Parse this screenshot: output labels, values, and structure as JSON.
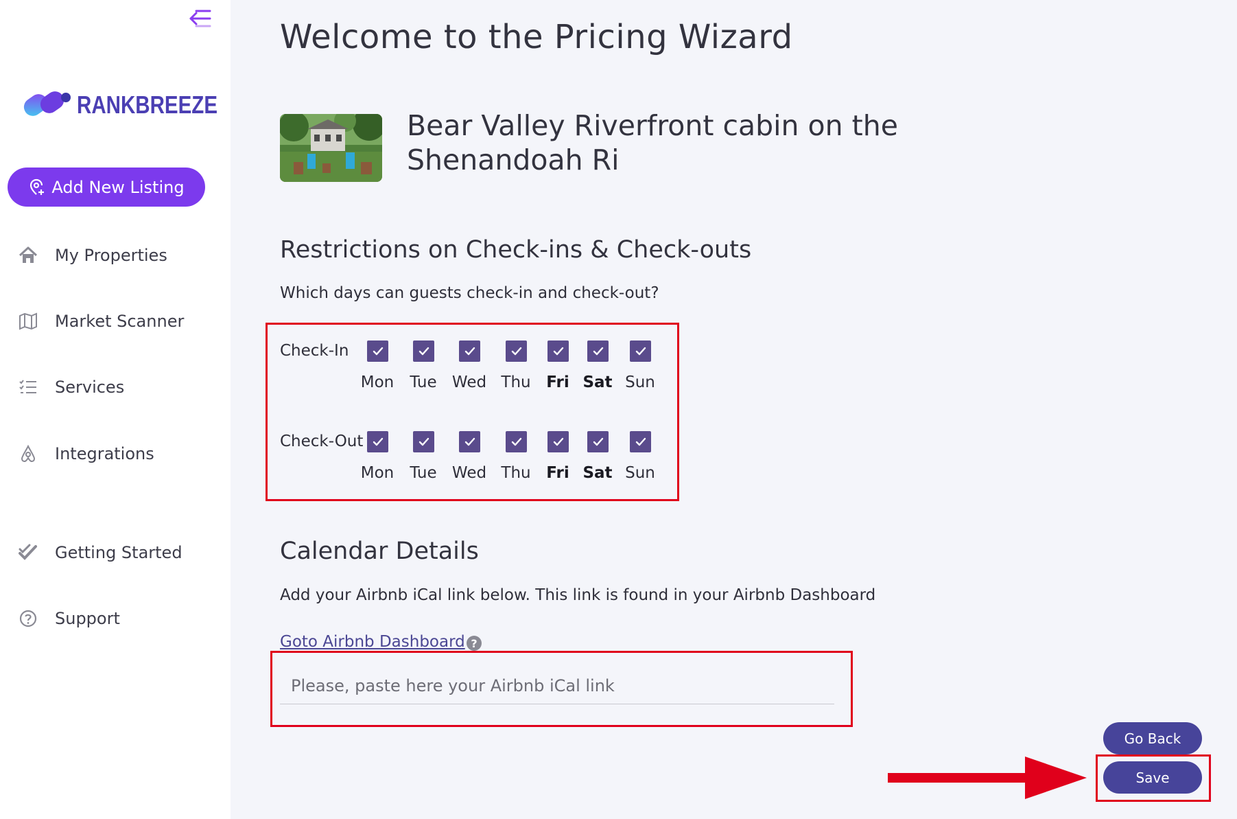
{
  "sidebar": {
    "logo_text": "RANKBREEZE",
    "add_button_label": "Add New Listing",
    "nav": [
      {
        "label": "My Properties",
        "icon": "home-icon"
      },
      {
        "label": "Market Scanner",
        "icon": "map-icon"
      },
      {
        "label": "Services",
        "icon": "list-check-icon"
      },
      {
        "label": "Integrations",
        "icon": "airbnb-icon"
      },
      {
        "label": "Getting Started",
        "icon": "double-check-icon"
      },
      {
        "label": "Support",
        "icon": "question-circle-icon"
      }
    ]
  },
  "main": {
    "page_title": "Welcome to the Pricing Wizard",
    "listing_title": "Bear Valley Riverfront cabin on the Shenandoah Ri",
    "restrictions": {
      "heading": "Restrictions on Check-ins & Check-outs",
      "question": "Which days can guests check-in and check-out?",
      "checkin_label": "Check-In",
      "checkout_label": "Check-Out",
      "days": [
        "Mon",
        "Tue",
        "Wed",
        "Thu",
        "Fri",
        "Sat",
        "Sun"
      ],
      "checkin_checked": [
        true,
        true,
        true,
        true,
        true,
        true,
        true
      ],
      "checkout_checked": [
        true,
        true,
        true,
        true,
        true,
        true,
        true
      ]
    },
    "calendar": {
      "heading": "Calendar Details",
      "description": "Add your Airbnb iCal link below. This link is found in your Airbnb Dashboard",
      "link_label": "Goto Airbnb Dashboard",
      "help_symbol": "?",
      "ical_placeholder": "Please, paste here your Airbnb iCal link",
      "ical_value": ""
    },
    "buttons": {
      "go_back": "Go Back",
      "save": "Save"
    }
  },
  "colors": {
    "accent": "#7c3aed",
    "checkbox": "#5a4b8c",
    "button": "#47449a",
    "annotation": "#e0001b"
  }
}
